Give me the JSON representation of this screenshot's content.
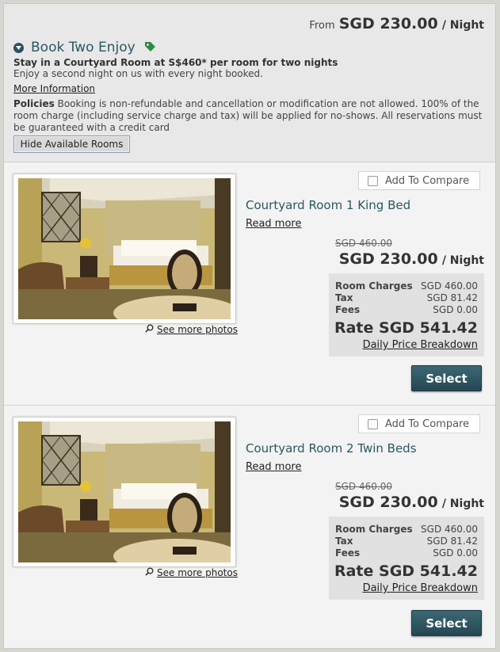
{
  "header": {
    "from_label": "From",
    "price": "SGD 230.00",
    "per_night": "/ Night"
  },
  "offer": {
    "title": "Book Two Enjoy",
    "subtitle": "Stay in a Courtyard Room at S$460* per room for two nights",
    "description": "Enjoy a second night on us with every night booked.",
    "more_info": "More Information",
    "policies_label": "Policies",
    "policies_text": "Booking is non-refundable and cancellation or modification are not allowed. 100% of the room charge (including service charge and tax) will be applied for no-shows. All reservations must be guaranteed with a credit card",
    "hide_button": "Hide Available Rooms",
    "icons": [
      "collapse-circle-icon",
      "tag-icon"
    ],
    "tag_color": "#2e8b3e"
  },
  "rooms": [
    {
      "name": "Courtyard Room 1 King Bed",
      "read_more": "Read more",
      "see_photos": "See more photos",
      "compare": "Add To Compare",
      "old_price": "SGD 460.00",
      "price": "SGD 230.00",
      "per_night": "/ Night",
      "room_charges_label": "Room Charges",
      "room_charges": "SGD 460.00",
      "tax_label": "Tax",
      "tax": "SGD 81.42",
      "fees_label": "Fees",
      "fees": "SGD 0.00",
      "rate": "Rate SGD 541.42",
      "daily_breakdown": "Daily Price Breakdown",
      "select": "Select"
    },
    {
      "name": "Courtyard Room 2 Twin Beds",
      "read_more": "Read more",
      "see_photos": "See more photos",
      "compare": "Add To Compare",
      "old_price": "SGD 460.00",
      "price": "SGD 230.00",
      "per_night": "/ Night",
      "room_charges_label": "Room Charges",
      "room_charges": "SGD 460.00",
      "tax_label": "Tax",
      "tax": "SGD 81.42",
      "fees_label": "Fees",
      "fees": "SGD 0.00",
      "rate": "Rate SGD 541.42",
      "daily_breakdown": "Daily Price Breakdown",
      "select": "Select"
    }
  ],
  "colors": {
    "accent": "#2b5765",
    "button": "#2f5866",
    "panel": "#e1e1e1"
  }
}
